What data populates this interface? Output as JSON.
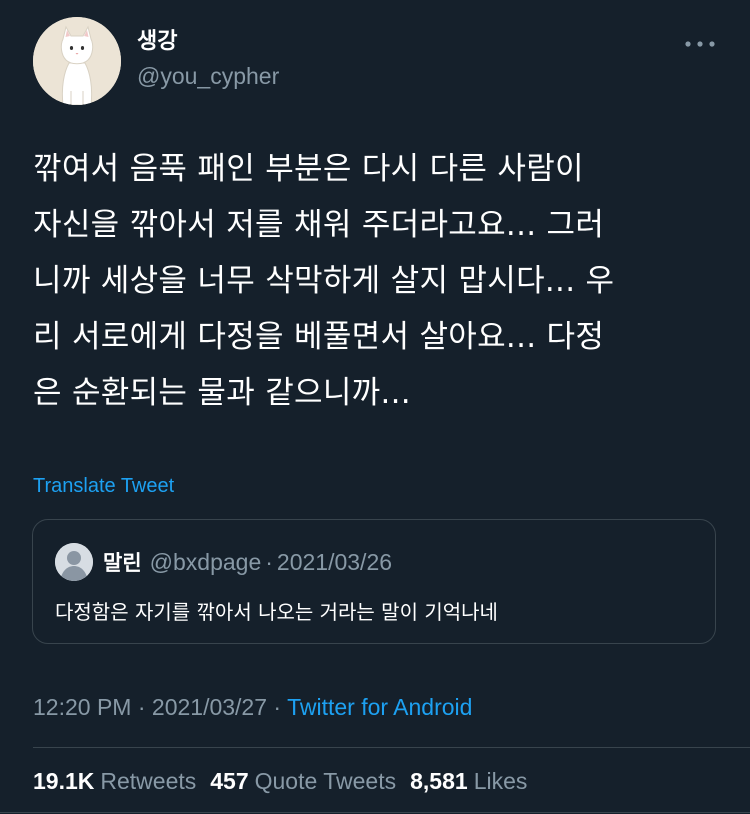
{
  "author": {
    "display_name": "생강",
    "handle": "@you_cypher",
    "avatar_icon": "white-cat-avatar"
  },
  "tweet": {
    "text": "깎여서 음푹 패인 부분은 다시 다른 사람이\n자신을 깎아서 저를 채워 주더라고요... 그러\n니까 세상을 너무 삭막하게 살지 맙시다... 우\n리 서로에게 다정을 베풀면서 살아요... 다정\n은 순환되는 물과 같으니까...",
    "translate_label": "Translate Tweet"
  },
  "quote": {
    "display_name": "말린",
    "handle": "@bxdpage",
    "date": "2021/03/26",
    "separator": "·",
    "text": "다정함은 자기를 깎아서 나오는 거라는 말이 기억나네",
    "avatar_icon": "default-user-avatar"
  },
  "meta": {
    "time": "12:20 PM",
    "separator": "·",
    "date": "2021/03/27",
    "source": "Twitter for Android"
  },
  "stats": {
    "retweets_count": "19.1K",
    "retweets_label": "Retweets",
    "quotes_count": "457",
    "quotes_label": "Quote Tweets",
    "likes_count": "8,581",
    "likes_label": "Likes"
  },
  "colors": {
    "background": "#15202b",
    "accent": "#1da1f2",
    "secondary_text": "#8899a6",
    "border": "#38444d"
  }
}
